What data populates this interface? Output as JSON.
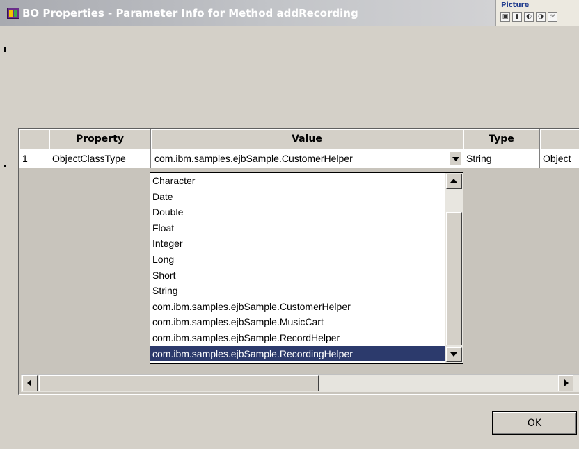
{
  "window": {
    "title": "BO Properties - Parameter  Info for Method addRecording"
  },
  "picture_toolbar": {
    "title": "Picture",
    "icons": [
      "image-icon",
      "bar-chart-icon",
      "contrast-more-icon",
      "contrast-less-icon",
      "brightness-icon"
    ]
  },
  "grid": {
    "columns": [
      "Property",
      "Value",
      "Type",
      ""
    ],
    "rows": [
      {
        "row_number": "1",
        "property": "ObjectClassType",
        "value": "com.ibm.samples.ejbSample.CustomerHelper",
        "type": "String",
        "extra": "Object"
      }
    ]
  },
  "dropdown": {
    "options": [
      "Character",
      "Date",
      "Double",
      "Float",
      "Integer",
      "Long",
      "Short",
      "String",
      "com.ibm.samples.ejbSample.CustomerHelper",
      "com.ibm.samples.ejbSample.MusicCart",
      "com.ibm.samples.ejbSample.RecordHelper",
      "com.ibm.samples.ejbSample.RecordingHelper"
    ],
    "selected": "com.ibm.samples.ejbSample.RecordingHelper"
  },
  "buttons": {
    "ok_label": "OK"
  },
  "colors": {
    "selection": "#2c3a6c",
    "title_text": "#ffffff"
  }
}
